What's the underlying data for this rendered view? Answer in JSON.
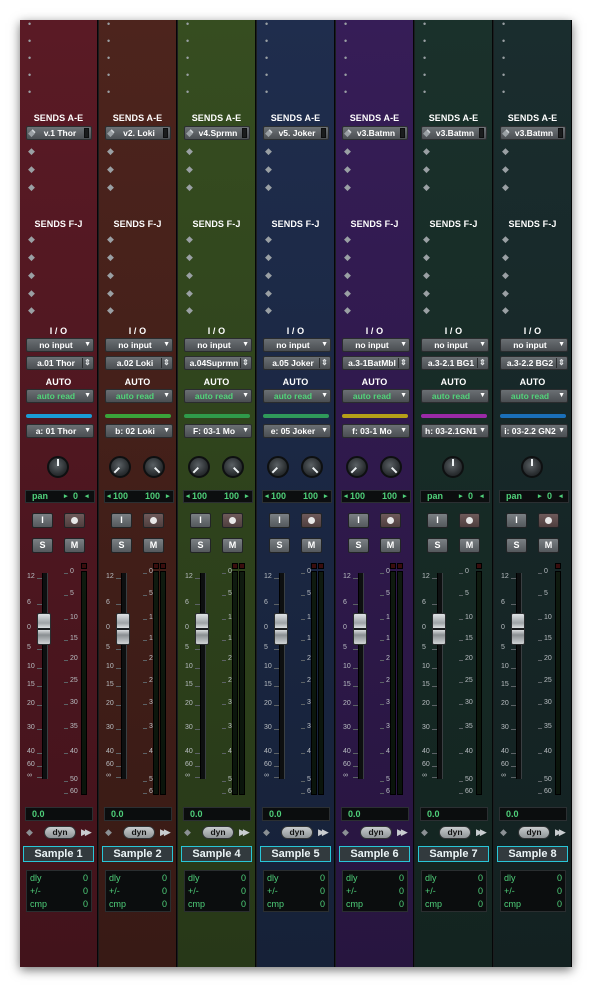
{
  "sends_ae_label": "SENDS A-E",
  "sends_fj_label": "SENDS F-J",
  "io_label": "I / O",
  "auto_label": "AUTO",
  "pan_label": "pan",
  "insert_button_label": "I",
  "solo_label": "S",
  "mute_label": "M",
  "dyn_label": "dyn",
  "fader_scale": [
    "12",
    "6",
    "0",
    "5",
    "10",
    "15",
    "20",
    "30",
    "40",
    "60",
    "∞"
  ],
  "meter_scale": [
    "0",
    "5",
    "10",
    "15",
    "20",
    "25",
    "30",
    "35",
    "40",
    "50",
    "60"
  ],
  "info_labels": [
    "dly",
    "+/-",
    "cmp"
  ],
  "channels": [
    {
      "name": "Sample 1",
      "send_a": "v.1 Thor",
      "input": "no input",
      "output": "a.01 Thor",
      "automation": "auto read",
      "routing": "a: 01 Thor",
      "pan_mode": "mono",
      "pan_value": "0",
      "pan_left": "",
      "pan_right": "",
      "volume": "0.0",
      "info_values": [
        "0",
        "0",
        "0"
      ],
      "color": "#6a1f2c",
      "bar_color": "#1a9dd6"
    },
    {
      "name": "Sample 2",
      "send_a": "v2. Loki",
      "input": "no input",
      "output": "a.02 Loki",
      "automation": "auto read",
      "routing": "b: 02 Loki",
      "pan_mode": "stereo",
      "pan_value": "",
      "pan_left": "100",
      "pan_right": "100",
      "volume": "0.0",
      "info_values": [
        "0",
        "0",
        "0"
      ],
      "color": "#5b2a22",
      "bar_color": "#3aa33a"
    },
    {
      "name": "Sample 4",
      "send_a": "v4.Sprmn",
      "input": "no input",
      "output": "a.04Suprmn",
      "automation": "auto read",
      "routing": "F: 03-1 Mo",
      "pan_mode": "stereo",
      "pan_value": "",
      "pan_left": "100",
      "pan_right": "100",
      "volume": "0.0",
      "info_values": [
        "0",
        "0",
        "0"
      ],
      "color": "#3f5a26",
      "bar_color": "#2f9a4a"
    },
    {
      "name": "Sample 5",
      "send_a": "v5. Joker",
      "input": "no input",
      "output": "a.05 Joker",
      "automation": "auto read",
      "routing": "e: 05 Joker",
      "pan_mode": "stereo",
      "pan_value": "",
      "pan_left": "100",
      "pan_right": "100",
      "volume": "0.0",
      "info_values": [
        "0",
        "0",
        "0"
      ],
      "color": "#24355a",
      "bar_color": "#2f9a5a"
    },
    {
      "name": "Sample 6",
      "send_a": "v3.Batmn",
      "input": "no input",
      "output": "a.3-1BatMbl",
      "automation": "auto read",
      "routing": "f: 03-1 Mo",
      "pan_mode": "stereo",
      "pan_value": "",
      "pan_left": "100",
      "pan_right": "100",
      "volume": "0.0",
      "info_values": [
        "0",
        "0",
        "0"
      ],
      "color": "#3f2266",
      "bar_color": "#b5a018"
    },
    {
      "name": "Sample 7",
      "send_a": "v3.Batmn",
      "input": "no input",
      "output": "a.3-2.1 BG1",
      "automation": "auto read",
      "routing": "h: 03-2.1GN1",
      "pan_mode": "mono",
      "pan_value": "0",
      "pan_left": "",
      "pan_right": "",
      "volume": "0.0",
      "info_values": [
        "0",
        "0",
        "0"
      ],
      "color": "#1f3a33",
      "bar_color": "#9a2aa6"
    },
    {
      "name": "Sample 8",
      "send_a": "v3.Batmn",
      "input": "no input",
      "output": "a.3-2.2 BG2",
      "automation": "auto read",
      "routing": "i: 03-2.2 GN2",
      "pan_mode": "mono",
      "pan_value": "0",
      "pan_left": "",
      "pan_right": "",
      "volume": "0.0",
      "info_values": [
        "0",
        "0",
        "0"
      ],
      "color": "#1e3536",
      "bar_color": "#1a6fb8"
    }
  ]
}
